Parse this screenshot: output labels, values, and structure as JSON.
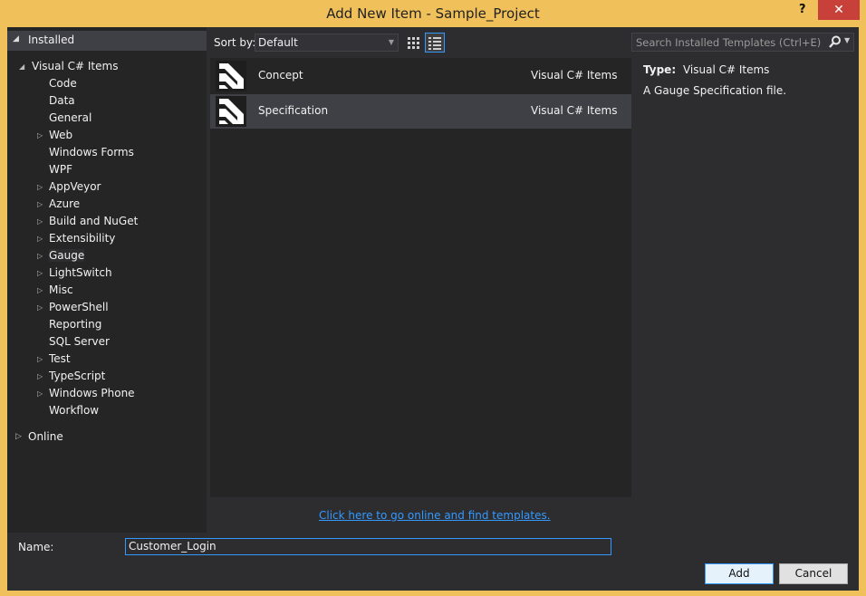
{
  "window": {
    "title": "Add New Item - Sample_Project",
    "help_label": "?",
    "close_label": "✕"
  },
  "tree": {
    "installed_label": "Installed",
    "root_label": "Visual C# Items",
    "items": [
      {
        "label": "Code",
        "expandable": false
      },
      {
        "label": "Data",
        "expandable": false
      },
      {
        "label": "General",
        "expandable": false
      },
      {
        "label": "Web",
        "expandable": true
      },
      {
        "label": "Windows Forms",
        "expandable": false
      },
      {
        "label": "WPF",
        "expandable": false
      },
      {
        "label": "AppVeyor",
        "expandable": true
      },
      {
        "label": "Azure",
        "expandable": true
      },
      {
        "label": "Build and NuGet",
        "expandable": true
      },
      {
        "label": "Extensibility",
        "expandable": true
      },
      {
        "label": "Gauge",
        "expandable": true,
        "selected": true
      },
      {
        "label": "LightSwitch",
        "expandable": true
      },
      {
        "label": "Misc",
        "expandable": true
      },
      {
        "label": "PowerShell",
        "expandable": true
      },
      {
        "label": "Reporting",
        "expandable": false
      },
      {
        "label": "SQL Server",
        "expandable": false
      },
      {
        "label": "Test",
        "expandable": true
      },
      {
        "label": "TypeScript",
        "expandable": true
      },
      {
        "label": "Windows Phone",
        "expandable": true
      },
      {
        "label": "Workflow",
        "expandable": false
      }
    ],
    "online_label": "Online"
  },
  "sort": {
    "label": "Sort by:",
    "value": "Default"
  },
  "templates": [
    {
      "name": "Concept",
      "category": "Visual C# Items",
      "selected": false
    },
    {
      "name": "Specification",
      "category": "Visual C# Items",
      "selected": true
    }
  ],
  "online_link": "Click here to go online and find templates.",
  "search": {
    "placeholder": "Search Installed Templates (Ctrl+E)"
  },
  "details": {
    "type_label": "Type:",
    "type_value": "Visual C# Items",
    "description": "A Gauge Specification file."
  },
  "form": {
    "name_label": "Name:",
    "name_value": "Customer_Login",
    "add_label": "Add",
    "cancel_label": "Cancel"
  },
  "colors": {
    "accent": "#3399ff",
    "title_bar": "#f0c05a",
    "close_button": "#c7413a",
    "background": "#2d2d30",
    "panel": "#252526"
  }
}
